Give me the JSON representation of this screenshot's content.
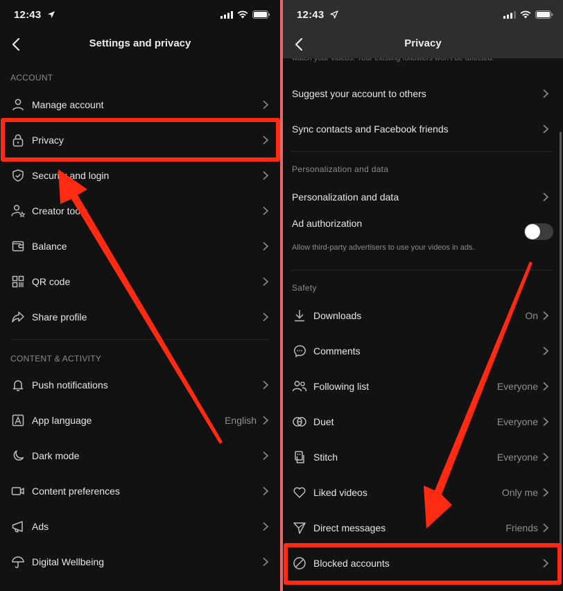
{
  "colors": {
    "background": "#121212",
    "divider_between_panels": "#e5676b",
    "annotation_red": "#ff2a12",
    "text_primary": "#e6e6e6",
    "text_secondary": "#8f8f8f"
  },
  "left": {
    "status": {
      "time": "12:43",
      "icons": [
        "location-arrow-icon",
        "signal-icon",
        "wifi-icon",
        "battery-icon"
      ]
    },
    "nav": {
      "title": "Settings and privacy",
      "back_icon": "chevron-left-icon"
    },
    "sections": [
      {
        "header": "ACCOUNT",
        "items": [
          {
            "label": "Manage account",
            "icon": "person-icon",
            "value": ""
          },
          {
            "label": "Privacy",
            "icon": "lock-icon",
            "value": "",
            "highlighted": true
          },
          {
            "label": "Security and login",
            "icon": "shield-check-icon",
            "value": ""
          },
          {
            "label": "Creator tools",
            "icon": "person-star-icon",
            "value": ""
          },
          {
            "label": "Balance",
            "icon": "wallet-icon",
            "value": ""
          },
          {
            "label": "QR code",
            "icon": "qr-code-icon",
            "value": ""
          },
          {
            "label": "Share profile",
            "icon": "share-arrow-icon",
            "value": ""
          }
        ]
      },
      {
        "header": "CONTENT & ACTIVITY",
        "items": [
          {
            "label": "Push notifications",
            "icon": "bell-icon",
            "value": ""
          },
          {
            "label": "App language",
            "icon": "letter-a-icon",
            "value": "English"
          },
          {
            "label": "Dark mode",
            "icon": "moon-icon",
            "value": ""
          },
          {
            "label": "Content preferences",
            "icon": "video-camera-icon",
            "value": ""
          },
          {
            "label": "Ads",
            "icon": "megaphone-icon",
            "value": ""
          },
          {
            "label": "Digital Wellbeing",
            "icon": "umbrella-icon",
            "value": ""
          }
        ]
      }
    ]
  },
  "right": {
    "status": {
      "time": "12:43",
      "icons": [
        "location-arrow-icon",
        "signal-icon",
        "wifi-icon",
        "battery-icon"
      ]
    },
    "nav": {
      "title": "Privacy",
      "back_icon": "chevron-left-icon"
    },
    "faded_text": "watch your videos. Your existing followers won't be affected.",
    "discoverability_items": [
      {
        "label": "Suggest your account to others"
      },
      {
        "label": "Sync contacts and Facebook friends"
      }
    ],
    "personalization": {
      "header": "Personalization and data",
      "item": {
        "label": "Personalization and data"
      },
      "ad_authorization": {
        "label": "Ad authorization",
        "description": "Allow third-party advertisers to use your videos in ads.",
        "enabled": false
      }
    },
    "safety": {
      "header": "Safety",
      "items": [
        {
          "label": "Downloads",
          "icon": "download-icon",
          "value": "On"
        },
        {
          "label": "Comments",
          "icon": "comment-bubble-icon",
          "value": ""
        },
        {
          "label": "Following list",
          "icon": "people-icon",
          "value": "Everyone"
        },
        {
          "label": "Duet",
          "icon": "duet-icon",
          "value": "Everyone"
        },
        {
          "label": "Stitch",
          "icon": "stitch-icon",
          "value": "Everyone"
        },
        {
          "label": "Liked videos",
          "icon": "heart-icon",
          "value": "Only me"
        },
        {
          "label": "Direct messages",
          "icon": "paper-plane-icon",
          "value": "Friends"
        },
        {
          "label": "Blocked accounts",
          "icon": "blocked-circle-icon",
          "value": "",
          "highlighted": true
        }
      ]
    }
  },
  "annotations": [
    {
      "type": "arrow",
      "points_to": "Privacy"
    },
    {
      "type": "arrow",
      "points_to": "Blocked accounts"
    }
  ]
}
